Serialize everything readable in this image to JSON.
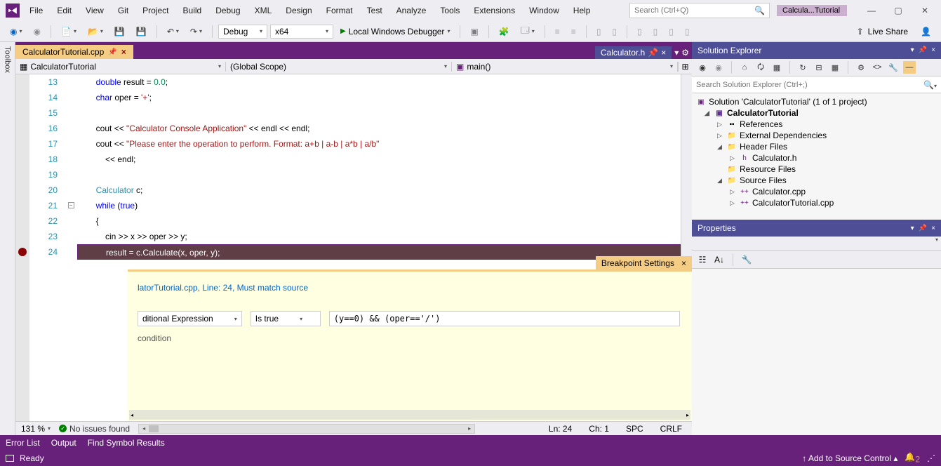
{
  "menu": [
    "File",
    "Edit",
    "View",
    "Git",
    "Project",
    "Build",
    "Debug",
    "XML",
    "Design",
    "Format",
    "Test",
    "Analyze",
    "Tools",
    "Extensions",
    "Window",
    "Help"
  ],
  "search_placeholder": "Search (Ctrl+Q)",
  "window_title": "Calcula...Tutorial",
  "toolbar": {
    "config": "Debug",
    "platform": "x64",
    "debugger": "Local Windows Debugger",
    "live_share": "Live Share"
  },
  "side_toolbox": "Toolbox",
  "editor": {
    "tab": "CalculatorTutorial.cpp",
    "nav_left": "CalculatorTutorial",
    "nav_mid": "(Global Scope)",
    "nav_right": "main()",
    "doc_selector": "Calculator.h",
    "lines": {
      "start": 13,
      "end": 24
    },
    "code": [
      {
        "n": 13,
        "frags": [
          {
            "t": "        ",
            "c": ""
          },
          {
            "t": "double",
            "c": "kw"
          },
          {
            "t": " result = ",
            "c": ""
          },
          {
            "t": "0.0",
            "c": "num"
          },
          {
            "t": ";",
            "c": ""
          }
        ]
      },
      {
        "n": 14,
        "frags": [
          {
            "t": "        ",
            "c": ""
          },
          {
            "t": "char",
            "c": "kw"
          },
          {
            "t": " oper = ",
            "c": ""
          },
          {
            "t": "'+'",
            "c": "ch"
          },
          {
            "t": ";",
            "c": ""
          }
        ]
      },
      {
        "n": 15,
        "frags": [
          {
            "t": "",
            "c": ""
          }
        ]
      },
      {
        "n": 16,
        "frags": [
          {
            "t": "        cout << ",
            "c": ""
          },
          {
            "t": "\"Calculator Console Application\"",
            "c": "str"
          },
          {
            "t": " << endl << endl;",
            "c": ""
          }
        ]
      },
      {
        "n": 17,
        "frags": [
          {
            "t": "        cout << ",
            "c": ""
          },
          {
            "t": "\"Please enter the operation to perform. Format: a+b | a-b | a*b | a/b\"",
            "c": "str"
          }
        ]
      },
      {
        "n": 18,
        "frags": [
          {
            "t": "            << endl;",
            "c": ""
          }
        ]
      },
      {
        "n": 19,
        "frags": [
          {
            "t": "",
            "c": ""
          }
        ]
      },
      {
        "n": 20,
        "frags": [
          {
            "t": "        ",
            "c": ""
          },
          {
            "t": "Calculator",
            "c": "cls"
          },
          {
            "t": " c;",
            "c": ""
          }
        ]
      },
      {
        "n": 21,
        "frags": [
          {
            "t": "        ",
            "c": ""
          },
          {
            "t": "while",
            "c": "kw"
          },
          {
            "t": " (",
            "c": ""
          },
          {
            "t": "true",
            "c": "kw"
          },
          {
            "t": ")",
            "c": ""
          }
        ]
      },
      {
        "n": 22,
        "frags": [
          {
            "t": "        {",
            "c": ""
          }
        ]
      },
      {
        "n": 23,
        "frags": [
          {
            "t": "            cin >> x >> oper >> y;",
            "c": ""
          }
        ]
      },
      {
        "n": 24,
        "hl": true,
        "frags": [
          {
            "t": "            result = c.Calculate(x, oper, y);",
            "c": ""
          }
        ]
      }
    ],
    "breakpoint_line": 24,
    "fold_line": 21
  },
  "breakpoint_settings": {
    "title": "Breakpoint Settings",
    "location": "latorTutorial.cpp, Line: 24, Must match source",
    "cond_type": "ditional Expression",
    "cond_eval": "Is true",
    "cond_expr": "(y==0) && (oper=='/')",
    "label": "condition"
  },
  "editor_footer": {
    "zoom": "131 %",
    "issues": "No issues found",
    "ln": "Ln: 24",
    "ch": "Ch: 1",
    "spc": "SPC",
    "crlf": "CRLF"
  },
  "solution_explorer": {
    "title": "Solution Explorer",
    "search_placeholder": "Search Solution Explorer (Ctrl+;)",
    "solution": "Solution 'CalculatorTutorial' (1 of 1 project)",
    "project": "CalculatorTutorial",
    "nodes": {
      "references": "References",
      "external": "External Dependencies",
      "headers": "Header Files",
      "header_file": "Calculator.h",
      "resources": "Resource Files",
      "sources": "Source Files",
      "source_files": [
        "Calculator.cpp",
        "CalculatorTutorial.cpp"
      ]
    }
  },
  "properties": {
    "title": "Properties"
  },
  "bottom_tabs": [
    "Error List",
    "Output",
    "Find Symbol Results"
  ],
  "status": {
    "ready": "Ready",
    "add_src": "Add to Source Control",
    "notif": "2"
  }
}
